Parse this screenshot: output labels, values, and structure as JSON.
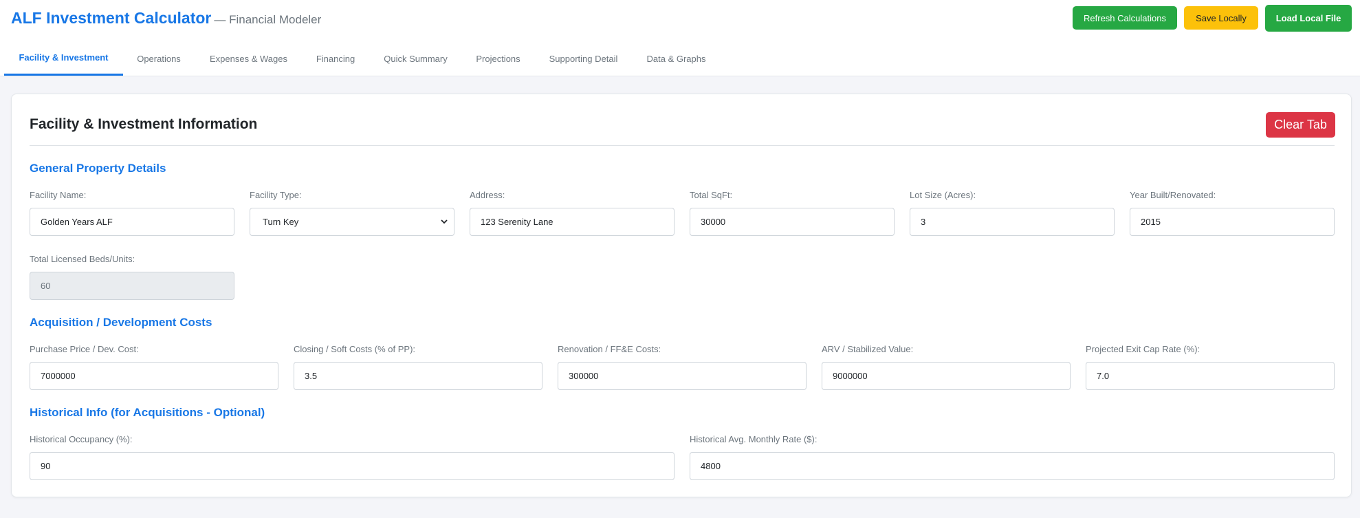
{
  "header": {
    "title": "ALF Investment Calculator",
    "subtitle": "— Financial Modeler",
    "buttons": {
      "refresh": "Refresh Calculations",
      "save": "Save Locally",
      "load": "Load Local File"
    }
  },
  "tabs": [
    {
      "label": "Facility & Investment",
      "active": true
    },
    {
      "label": "Operations"
    },
    {
      "label": "Expenses & Wages"
    },
    {
      "label": "Financing"
    },
    {
      "label": "Quick Summary"
    },
    {
      "label": "Projections"
    },
    {
      "label": "Supporting Detail"
    },
    {
      "label": "Data & Graphs"
    }
  ],
  "card": {
    "title": "Facility & Investment Information",
    "clear_label": "Clear Tab"
  },
  "general": {
    "title": "General Property Details",
    "facility_name": {
      "label": "Facility Name:",
      "value": "Golden Years ALF"
    },
    "facility_type": {
      "label": "Facility Type:",
      "value": "Turn Key"
    },
    "address": {
      "label": "Address:",
      "value": "123 Serenity Lane"
    },
    "total_sqft": {
      "label": "Total SqFt:",
      "value": "30000"
    },
    "lot_size": {
      "label": "Lot Size (Acres):",
      "value": "3"
    },
    "year_built": {
      "label": "Year Built/Renovated:",
      "value": "2015"
    },
    "licensed_beds": {
      "label": "Total Licensed Beds/Units:",
      "value": "60"
    }
  },
  "acquisition": {
    "title": "Acquisition / Development Costs",
    "purchase_price": {
      "label": "Purchase Price / Dev. Cost:",
      "value": "7000000"
    },
    "closing_costs": {
      "label": "Closing / Soft Costs (% of PP):",
      "value": "3.5"
    },
    "renovation": {
      "label": "Renovation / FF&E Costs:",
      "value": "300000"
    },
    "arv": {
      "label": "ARV / Stabilized Value:",
      "value": "9000000"
    },
    "exit_cap": {
      "label": "Projected Exit Cap Rate (%):",
      "value": "7.0"
    }
  },
  "historical": {
    "title": "Historical Info (for Acquisitions - Optional)",
    "occupancy": {
      "label": "Historical Occupancy (%):",
      "value": "90"
    },
    "monthly_rate": {
      "label": "Historical Avg. Monthly Rate ($):",
      "value": "4800"
    }
  },
  "colors": {
    "primary": "#1877e6",
    "success": "#26a843",
    "warning": "#fcc10a",
    "danger": "#dc3545"
  }
}
